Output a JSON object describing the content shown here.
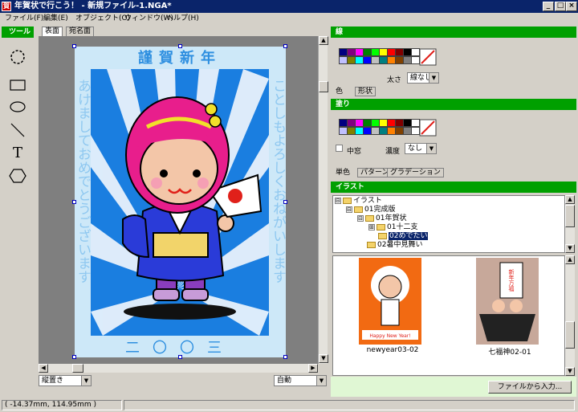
{
  "window": {
    "icon_text": "賀",
    "title": "年賀状で行こう！ - 新規ファイル-1.NGA*",
    "min_label": "_",
    "max_label": "□",
    "close_label": "×"
  },
  "menu": [
    "ファイル(F)",
    "編集(E)",
    "オブジェクト(O)",
    "ウィンドウ(W)",
    "ヘルプ(H)"
  ],
  "toolbox": {
    "header": "ツール",
    "tools": [
      "lasso-tool",
      "rectangle-tool",
      "ellipse-tool",
      "line-tool",
      "text-tool",
      "polygon-tool"
    ],
    "text_tool_glyph": "T"
  },
  "canvas": {
    "tabs": [
      "表面",
      "宛名面"
    ],
    "card": {
      "heading": "謹賀新年",
      "left_text": "あけましておめでとうございます",
      "right_text": "ことしもよろしくおねがいします",
      "year": "二〇〇三",
      "fan_mark_color": "#e0201a",
      "background_blue": "#1a7ee0",
      "border_color": "#cde8f8"
    },
    "orientation_select": "縦置き",
    "zoom_select": "自動"
  },
  "line_panel": {
    "header": "線",
    "width_label": "太さ",
    "width_value": "線なし",
    "tabs": [
      "色",
      "形状"
    ]
  },
  "fill_panel": {
    "header": "塗り",
    "hollow_label": "中窓",
    "density_label": "濃度",
    "density_value": "なし",
    "tabs": [
      "単色",
      "パターン",
      "グラデーション"
    ]
  },
  "palette": {
    "row1": [
      "#000080",
      "#800080",
      "#ff00ff",
      "#008000",
      "#00ff00",
      "#ffff00",
      "#ff0000",
      "#800000",
      "#000000",
      "#ffffff"
    ],
    "row2": [
      "#c0c0ff",
      "#808000",
      "#00ffff",
      "#0000ff",
      "#c0c0c0",
      "#008080",
      "#ff8000",
      "#804000",
      "#808080",
      "#ffffff"
    ]
  },
  "illust_panel": {
    "header": "イラスト",
    "tree": [
      {
        "label": "イラスト",
        "level": 0,
        "expander": "⊟"
      },
      {
        "label": "01完成版",
        "level": 1,
        "expander": "⊟"
      },
      {
        "label": "01年賀状",
        "level": 2,
        "expander": "⊟"
      },
      {
        "label": "01十二支",
        "level": 3,
        "expander": "⊞"
      },
      {
        "label": "02めでたい",
        "level": 3,
        "expander": "",
        "selected": true
      },
      {
        "label": "02暑中見舞い",
        "level": 2,
        "expander": ""
      }
    ],
    "thumbnails": [
      {
        "caption": "newyear03-02",
        "banner_text": "Happy New Year!"
      },
      {
        "caption": "七福神02-01",
        "banner_text": "新年万福"
      }
    ],
    "import_button": "ファイルから入力..."
  },
  "status": {
    "coords": "( -14.37mm, 114.95mm )"
  }
}
